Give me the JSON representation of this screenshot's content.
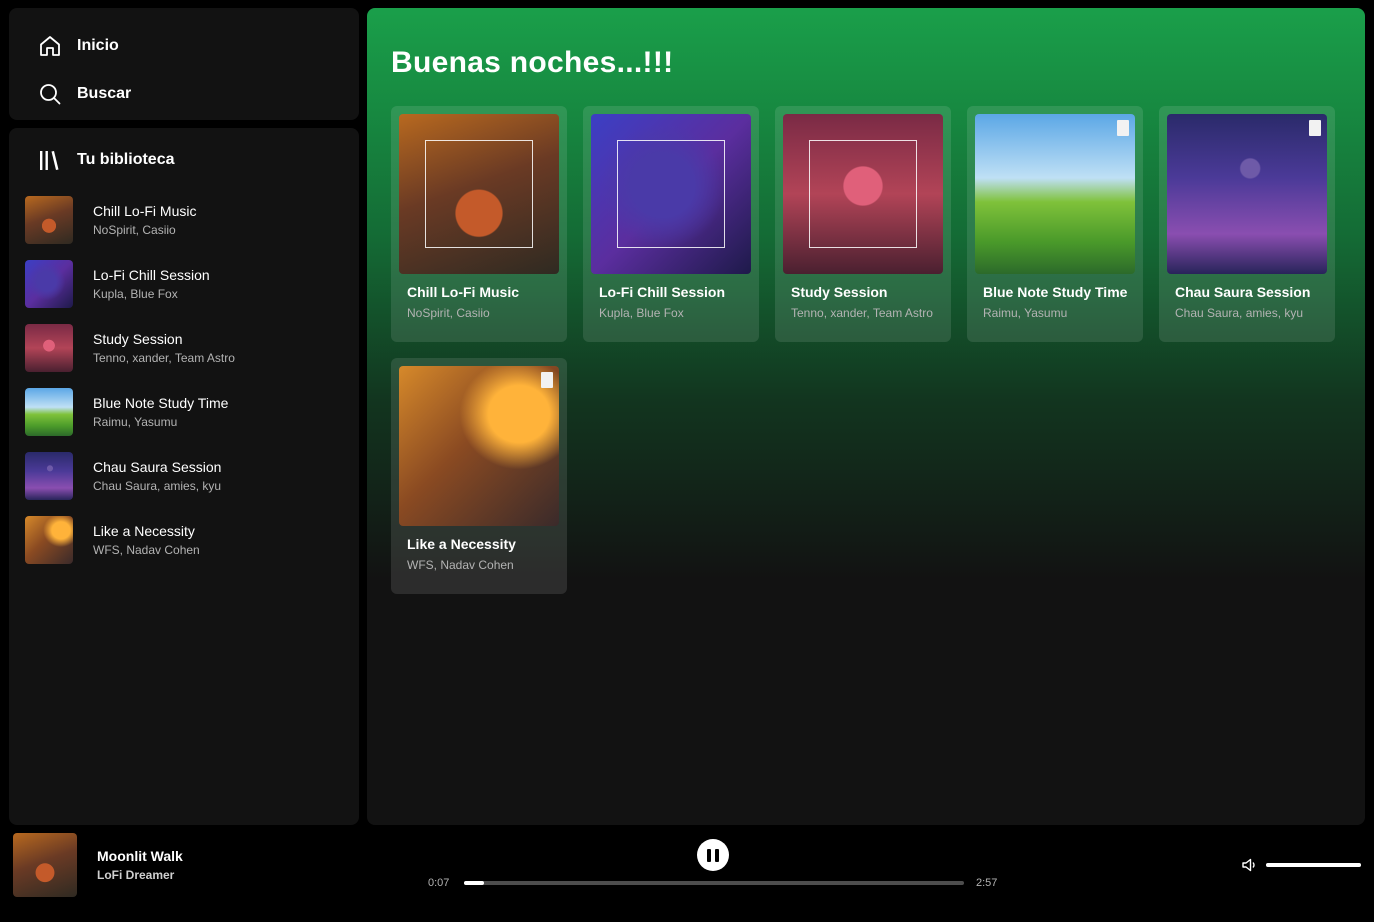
{
  "nav": {
    "home": {
      "label": "Inicio",
      "icon": "home-icon"
    },
    "search": {
      "label": "Buscar",
      "icon": "search-icon"
    }
  },
  "library": {
    "title": "Tu biblioteca",
    "icon": "library-icon",
    "items": [
      {
        "title": "Chill Lo-Fi Music",
        "subtitle": "NoSpirit, Casiio"
      },
      {
        "title": "Lo-Fi Chill Session",
        "subtitle": "Kupla, Blue Fox"
      },
      {
        "title": "Study Session",
        "subtitle": "Tenno, xander, Team Astro"
      },
      {
        "title": "Blue Note Study Time",
        "subtitle": "Raimu, Yasumu"
      },
      {
        "title": "Chau Saura Session",
        "subtitle": "Chau Saura, amies, kyu"
      },
      {
        "title": "Like a Necessity",
        "subtitle": "WFS, Nadav Cohen"
      }
    ]
  },
  "main": {
    "greeting": "Buenas noches...!!!",
    "cards": [
      {
        "title": "Chill Lo-Fi Music",
        "subtitle": "NoSpirit, Casiio"
      },
      {
        "title": "Lo-Fi Chill Session",
        "subtitle": "Kupla, Blue Fox"
      },
      {
        "title": "Study Session",
        "subtitle": "Tenno, xander, Team Astro"
      },
      {
        "title": "Blue Note Study Time",
        "subtitle": "Raimu, Yasumu"
      },
      {
        "title": "Chau Saura Session",
        "subtitle": "Chau Saura, amies, kyu"
      },
      {
        "title": "Like a Necessity",
        "subtitle": "WFS, Nadav Cohen"
      }
    ]
  },
  "player": {
    "track_title": "Moonlit Walk",
    "artist": "LoFi Dreamer",
    "elapsed": "0:07",
    "duration": "2:57",
    "progress": 0.04,
    "volume": 1.0,
    "state": "playing"
  },
  "colors": {
    "accent_green": "#1a9f4a",
    "panel": "#121212",
    "muted_text": "#b3b3b3"
  }
}
